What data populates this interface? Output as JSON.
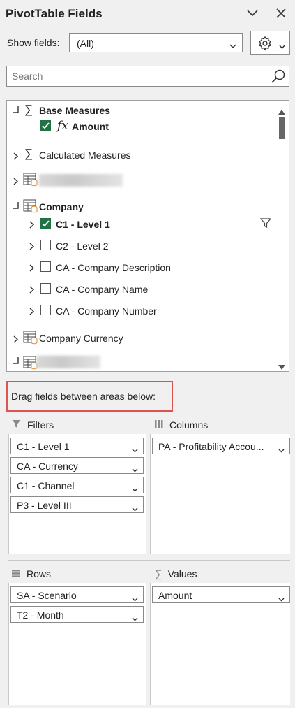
{
  "panel": {
    "title": "PivotTable Fields"
  },
  "show_fields": {
    "label": "Show fields:",
    "value": "(All)"
  },
  "search": {
    "placeholder": "Search"
  },
  "tree": {
    "base_measures": {
      "label": "Base Measures",
      "children": [
        {
          "label": "Amount",
          "checked": true
        }
      ]
    },
    "calculated_measures": {
      "label": "Calculated Measures"
    },
    "company": {
      "label": "Company",
      "children": [
        {
          "label": "C1 - Level 1",
          "checked": true,
          "filtered": true
        },
        {
          "label": "C2 - Level 2",
          "checked": false
        },
        {
          "label": "CA - Company Description",
          "checked": false
        },
        {
          "label": "CA - Company Name",
          "checked": false
        },
        {
          "label": "CA - Company Number",
          "checked": false
        }
      ]
    },
    "company_currency": {
      "label": "Company Currency"
    }
  },
  "drag_hint": "Drag fields between areas below:",
  "areas": {
    "filters": {
      "label": "Filters",
      "items": [
        "C1 - Level 1",
        "CA - Currency",
        "C1 - Channel",
        "P3 - Level III"
      ]
    },
    "columns": {
      "label": "Columns",
      "items": [
        "PA - Profitability Accou..."
      ]
    },
    "rows": {
      "label": "Rows",
      "items": [
        "SA - Scenario",
        "T2 - Month"
      ]
    },
    "values": {
      "label": "Values",
      "items": [
        "Amount"
      ]
    }
  },
  "colors": {
    "accent_green": "#217346",
    "highlight_red": "#e05252"
  }
}
